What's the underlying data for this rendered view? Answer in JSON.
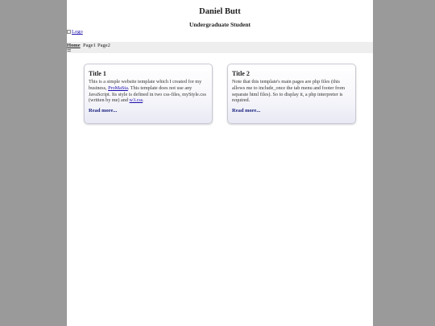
{
  "header": {
    "title": "Daniel Butt",
    "subtitle": "Undergraduate Student",
    "logo_alt": "Logo"
  },
  "nav": {
    "items": [
      "Home",
      "Page1",
      "Page2"
    ],
    "active": "Home",
    "menu_icon": "hamburger-menu-icon"
  },
  "cards": [
    {
      "title": "Title 1",
      "text_before_link": "This is a simple website template which I created for my business, ",
      "link1": "ProMaSta",
      "text_middle": ". This template does not use any JavaScript. Its style is defined in two css-files, myStyle.css (written by me) and ",
      "link2": "w3.css",
      "text_after_link": ".",
      "read_more": "Read more..."
    },
    {
      "title": "Title 2",
      "text": "Note that this template's main pages are php files (this allows me to include_once the tab menu and footer from separate html files). So to display it, a php interpreter is required.",
      "read_more": "Read more..."
    }
  ],
  "colors": {
    "background": "#9a9a9a",
    "page": "#ffffff",
    "nav_bar": "#eeeeee",
    "link": "#1a0dab",
    "read_more": "#1a237e"
  }
}
